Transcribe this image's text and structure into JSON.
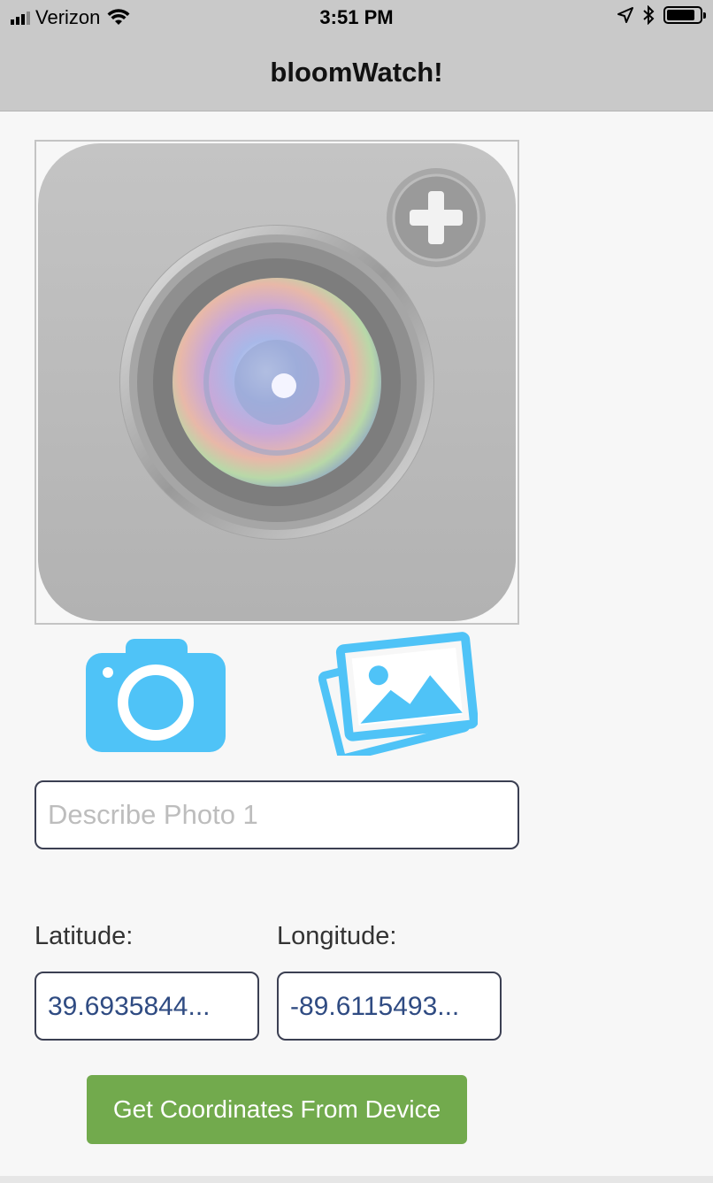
{
  "status_bar": {
    "carrier": "Verizon",
    "time": "3:51 PM",
    "icons": [
      "signal-icon",
      "wifi-icon",
      "location-icon",
      "bluetooth-icon",
      "battery-icon"
    ]
  },
  "nav": {
    "title": "bloomWatch!"
  },
  "photo": {
    "placeholder_icon": "camera-add-icon"
  },
  "actions": {
    "camera_icon": "camera-icon",
    "gallery_icon": "gallery-icon",
    "accent_color": "#4fc3f7"
  },
  "form": {
    "description_placeholder": "Describe Photo 1",
    "description_value": "",
    "latitude_label": "Latitude:",
    "longitude_label": "Longitude:",
    "latitude_value": "39.6935844...",
    "longitude_value": "-89.6115493...",
    "get_coords_label": "Get Coordinates From Device",
    "button_color": "#72aa4d"
  }
}
